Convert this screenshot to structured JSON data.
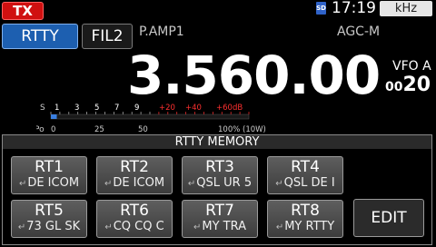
{
  "status_bar": {
    "tx": "TX",
    "sd": "SD",
    "time": "17:19",
    "khz": "kHz"
  },
  "mode": {
    "mode": "RTTY",
    "filter": "FIL2",
    "preamp": "P.AMP1",
    "agc": "AGC-M"
  },
  "frequency": "3.560.00",
  "vfo": {
    "label": "VFO A",
    "digits_small": "00",
    "digits": "20"
  },
  "meter": {
    "s_label": "S",
    "s_scale": [
      "1",
      "3",
      "5",
      "7",
      "9",
      "+20",
      "+40",
      "+60dB"
    ],
    "po_label": "Po",
    "po_scale": [
      "0",
      "25",
      "50",
      "100% (10W)"
    ],
    "level": 0.03,
    "colors": {
      "normal": "#ffffff",
      "over": "#ff3030",
      "bar": "#3a7fe0"
    }
  },
  "memory": {
    "title": "RTTY MEMORY",
    "return_glyph": "↵",
    "buttons": [
      {
        "title": "RT1",
        "text": "DE ICOM"
      },
      {
        "title": "RT2",
        "text": "DE ICOM"
      },
      {
        "title": "RT3",
        "text": "QSL UR 5"
      },
      {
        "title": "RT4",
        "text": "QSL DE I"
      },
      {
        "title": "RT5",
        "text": "73 GL SK"
      },
      {
        "title": "RT6",
        "text": "CQ CQ C"
      },
      {
        "title": "RT7",
        "text": "MY TRA"
      },
      {
        "title": "RT8",
        "text": "MY RTTY"
      }
    ],
    "edit": "EDIT"
  }
}
